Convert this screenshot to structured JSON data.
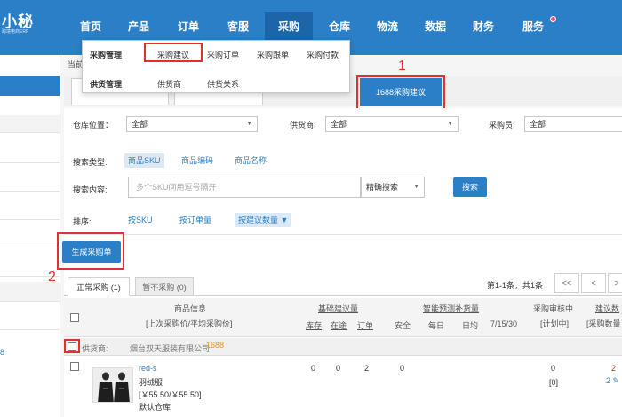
{
  "logo": {
    "name": "小秘",
    "subtitle": "跨境电商ERP"
  },
  "nav": {
    "items": [
      {
        "label": "首页",
        "active": false
      },
      {
        "label": "产品",
        "active": false
      },
      {
        "label": "订单",
        "active": false
      },
      {
        "label": "客服",
        "active": false
      },
      {
        "label": "采购",
        "active": true
      },
      {
        "label": "仓库",
        "active": false
      },
      {
        "label": "物流",
        "active": false
      },
      {
        "label": "数据",
        "active": false
      },
      {
        "label": "财务",
        "active": false
      },
      {
        "label": "服务",
        "active": false
      }
    ]
  },
  "dropdown": {
    "group1": "采购管理",
    "group1_items": [
      "采购建议",
      "采购订单",
      "采购跟单",
      "采购付款"
    ],
    "group2": "供货管理",
    "group2_items": [
      "供货商",
      "供货关系"
    ]
  },
  "breadcrumb": "当前",
  "tab_1688": "1688采购建议",
  "sidebar": {
    "link": "8"
  },
  "filters": {
    "warehouse_label": "仓库位置：",
    "warehouse_value": "全部",
    "supplier_label": "供货商:",
    "supplier_value": "全部",
    "buyer_label": "采购员:",
    "buyer_value": "全部",
    "search_type_label": "搜索类型:",
    "search_types": [
      "商品SKU",
      "商品编码",
      "商品名称"
    ],
    "search_content_label": "搜索内容:",
    "search_placeholder": "多个SKU间用逗号隔开",
    "match_mode": "精确搜索",
    "search_button": "搜索",
    "sort_label": "排序:",
    "sort_options": [
      "按SKU",
      "按订单量",
      "按建议数量 ▼"
    ]
  },
  "generate_button": "生成采购单",
  "result_tabs": [
    "正常采购 (1)",
    "暂不采购 (0)"
  ],
  "pagination": {
    "summary": "第1-1条，共1条",
    "first": "<<",
    "prev": "<",
    "next": ">"
  },
  "table": {
    "col_product": "商品信息",
    "col_product_sub": "[上次采购价/平均采购价]",
    "col_basic": "基础建议量",
    "col_basic_sub": [
      "库存",
      "在途",
      "订单"
    ],
    "col_smart": "智能预测补货量",
    "col_smart_sub": [
      "安全",
      "每日",
      "日均",
      "7/15/30"
    ],
    "col_review": "采购审核中",
    "col_review_sub": "[计划中]",
    "col_suggest": "建议数",
    "col_suggest_sub": "[采购数量"
  },
  "supplier_row": {
    "label": "供货商:",
    "name": "烟台双天服装有限公司",
    "tag": "1688"
  },
  "product": {
    "sku": "red-s",
    "name": "羽绒服",
    "price": "[￥55.50/￥55.50]",
    "warehouse": "默认仓库",
    "stock": "0",
    "transit": "0",
    "order": "2",
    "safety": "0",
    "review": "0",
    "plan": "[0]",
    "suggest": "2",
    "suggest_qty": "2"
  },
  "annotations": {
    "one": "1",
    "two": "2"
  }
}
